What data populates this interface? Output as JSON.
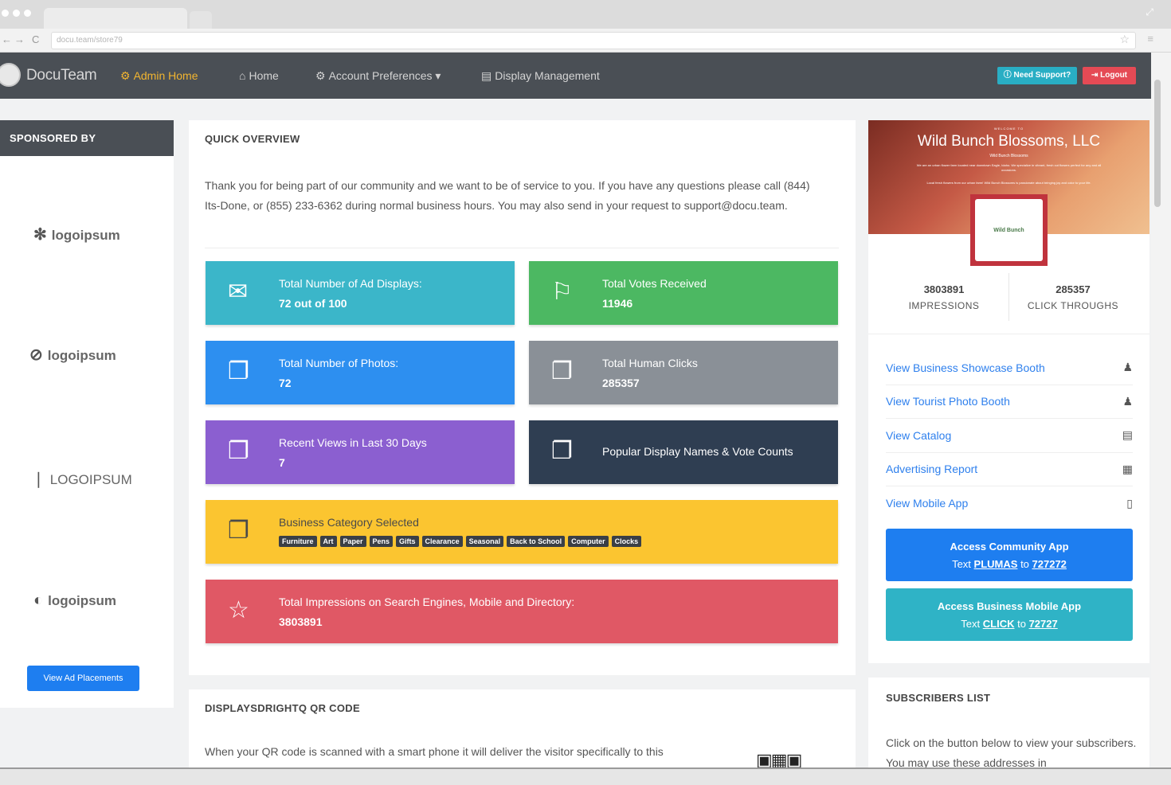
{
  "browser": {
    "url": "docu.team/store79",
    "nav_back": "←",
    "nav_forward": "→",
    "nav_reload": "C"
  },
  "nav": {
    "logo": "DocuTeam",
    "items": [
      {
        "label": "Admin Home",
        "icon": "gears-icon",
        "glyph": "⚙",
        "active": true
      },
      {
        "label": "Home",
        "icon": "home-icon",
        "glyph": "⌂",
        "active": false
      },
      {
        "label": "Account Preferences ▾",
        "icon": "settings-icon",
        "glyph": "⚙",
        "active": false
      },
      {
        "label": "Display Management",
        "icon": "archive-icon",
        "glyph": "▤",
        "active": false
      }
    ],
    "support_label": "Need Support?",
    "logout_label": "Logout"
  },
  "sponsored": {
    "heading": "SPONSORED BY",
    "logos": [
      "logoipsum",
      "logoipsum",
      "LOGOIPSUM",
      "logoipsum"
    ],
    "button_label": "View Ad Placements"
  },
  "overview": {
    "heading": "QUICK OVERVIEW",
    "paragraph": "Thank you for being part of our community and we want to be of service to you. If you have any questions please call (844) Its-Done, or (855) 233-6362 during normal business hours. You may also send in your request to support@docu.team.",
    "tiles": [
      {
        "title": "Total Number of Ad Displays:",
        "value": "72 out of 100",
        "icon": "envelope-icon",
        "color": "#3bb6c9"
      },
      {
        "title": "Total Votes Received",
        "value": "11946",
        "icon": "flag-icon",
        "color": "#4cb862"
      },
      {
        "title": "Total Number of Photos:",
        "value": "72",
        "icon": "copy-icon",
        "color": "#2d8ff0"
      },
      {
        "title": "Total Human Clicks",
        "value": "285357",
        "icon": "copy-icon",
        "color": "#8a9097"
      },
      {
        "title": "Recent Views in Last 30 Days",
        "value": "7",
        "icon": "copy-icon",
        "color": "#8b5fd0"
      },
      {
        "title": "Popular Display Names & Vote Counts",
        "value": "",
        "icon": "copy-icon",
        "color": "#2f3e52"
      },
      {
        "title": "Business Category Selected",
        "value": "",
        "icon": "copy-icon",
        "color": "#fbc530"
      },
      {
        "title": "Total Impressions on Search Engines, Mobile and Directory:",
        "value": "3803891",
        "icon": "star-icon",
        "color": "#e05865"
      }
    ],
    "categories": [
      "Furniture",
      "Art",
      "Paper",
      "Pens",
      "Gifts",
      "Clearance",
      "Seasonal",
      "Back to School",
      "Computer",
      "Clocks"
    ]
  },
  "qr": {
    "heading": "DISPLAYSDRIGHTQ QR CODE",
    "paragraph": "When your QR code is scanned with a smart phone it will deliver the visitor specifically to this"
  },
  "profile": {
    "welcome": "WELCOME TO",
    "business_name": "Wild Bunch Blossoms, LLC",
    "sub": "Wild Bunch Blossoms",
    "line1": "We are an urban flower farm located near downtown Eagle, Idaho. We specialize in vibrant, fresh cut flowers perfect for any and all occasions.",
    "line2": "Local fresh flowers from our urban farm! Wild Bunch Blossoms is passionate about bringing joy and color to your life.",
    "avatar_text": "Wild Bunch",
    "impressions": "3803891",
    "impressions_label": "IMPRESSIONS",
    "clicks": "285357",
    "clicks_label": "CLICK THROUGHS",
    "links": [
      {
        "label": "View Business Showcase Booth",
        "icon": "person-icon",
        "glyph": "♟"
      },
      {
        "label": "View Tourist Photo Booth",
        "icon": "person-icon",
        "glyph": "♟"
      },
      {
        "label": "View Catalog",
        "icon": "catalog-icon",
        "glyph": "▤"
      },
      {
        "label": "Advertising Report",
        "icon": "chart-icon",
        "glyph": "▦"
      },
      {
        "label": "View Mobile App",
        "icon": "mobile-icon",
        "glyph": "▯"
      }
    ],
    "community_app": {
      "title": "Access Community App",
      "prefix": "Text",
      "keyword": "PLUMAS",
      "mid": "to",
      "number": "727272",
      "color": "#1e7ef0"
    },
    "business_app": {
      "title": "Access Business Mobile App",
      "prefix": "Text",
      "keyword": "CLICK",
      "mid": "to",
      "number": "72727",
      "color": "#2fb3c6"
    }
  },
  "subscribers": {
    "heading": "SUBSCRIBERS LIST",
    "paragraph": "Click on the button below to view your subscribers. You may use these addresses in"
  }
}
